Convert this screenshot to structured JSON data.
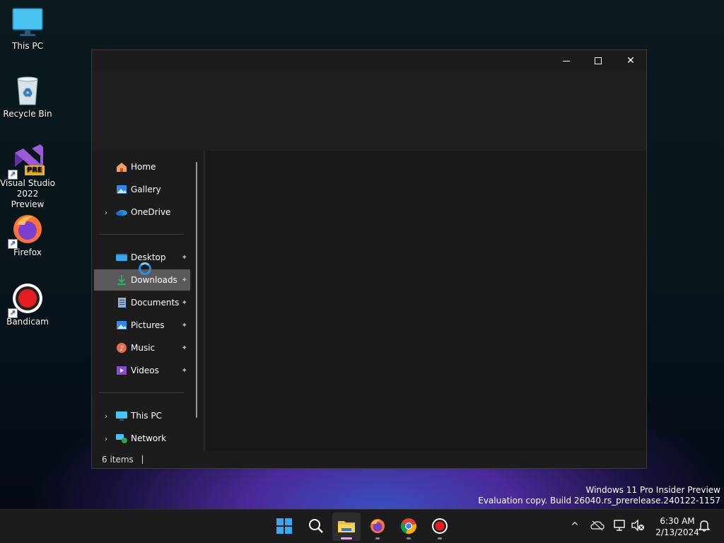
{
  "desktop": {
    "icons": [
      {
        "label": "This PC"
      },
      {
        "label": "Recycle Bin"
      },
      {
        "label": "Visual Studio 2022 Preview",
        "line1": "Visual Studio",
        "line2": "2022 Preview",
        "badge": "PRE"
      },
      {
        "label": "Firefox"
      },
      {
        "label": "Bandicam"
      }
    ]
  },
  "explorer": {
    "window_buttons": {
      "minimize": "—",
      "maximize": "☐",
      "close": "✕"
    },
    "nav": {
      "items": [
        {
          "label": "Home",
          "icon": "home-icon"
        },
        {
          "label": "Gallery",
          "icon": "gallery-icon"
        },
        {
          "label": "OneDrive",
          "icon": "onedrive-icon",
          "expandable": true
        },
        {
          "label": "Desktop",
          "icon": "desktop-folder-icon",
          "pinned": true
        },
        {
          "label": "Downloads",
          "icon": "downloads-folder-icon",
          "pinned": true,
          "selected": true
        },
        {
          "label": "Documents",
          "icon": "documents-folder-icon",
          "pinned": true
        },
        {
          "label": "Pictures",
          "icon": "pictures-folder-icon",
          "pinned": true
        },
        {
          "label": "Music",
          "icon": "music-folder-icon",
          "pinned": true
        },
        {
          "label": "Videos",
          "icon": "videos-folder-icon",
          "pinned": true
        },
        {
          "label": "This PC",
          "icon": "this-pc-icon",
          "expandable": true
        },
        {
          "label": "Network",
          "icon": "network-icon",
          "expandable": true
        }
      ],
      "chevron": "›",
      "pin_glyph": "📌"
    },
    "status": {
      "items_count": "6 items"
    }
  },
  "watermark": {
    "line1": "Windows 11 Pro Insider Preview",
    "line2": "Evaluation copy. Build 26040.rs_prerelease.240122-1157"
  },
  "taskbar": {
    "apps": [
      {
        "name": "start-icon"
      },
      {
        "name": "search-icon"
      },
      {
        "name": "file-explorer-icon",
        "active": true
      },
      {
        "name": "firefox-icon"
      },
      {
        "name": "chrome-icon"
      },
      {
        "name": "bandicam-icon"
      }
    ],
    "tray": {
      "chevron": "^"
    },
    "clock": {
      "time": "6:30 AM",
      "date": "2/13/2024"
    }
  },
  "colors": {
    "accent": "#2a8ee0",
    "selected_bg": "#5a5a5a",
    "taskbar_bg": "#1c1c1c"
  }
}
